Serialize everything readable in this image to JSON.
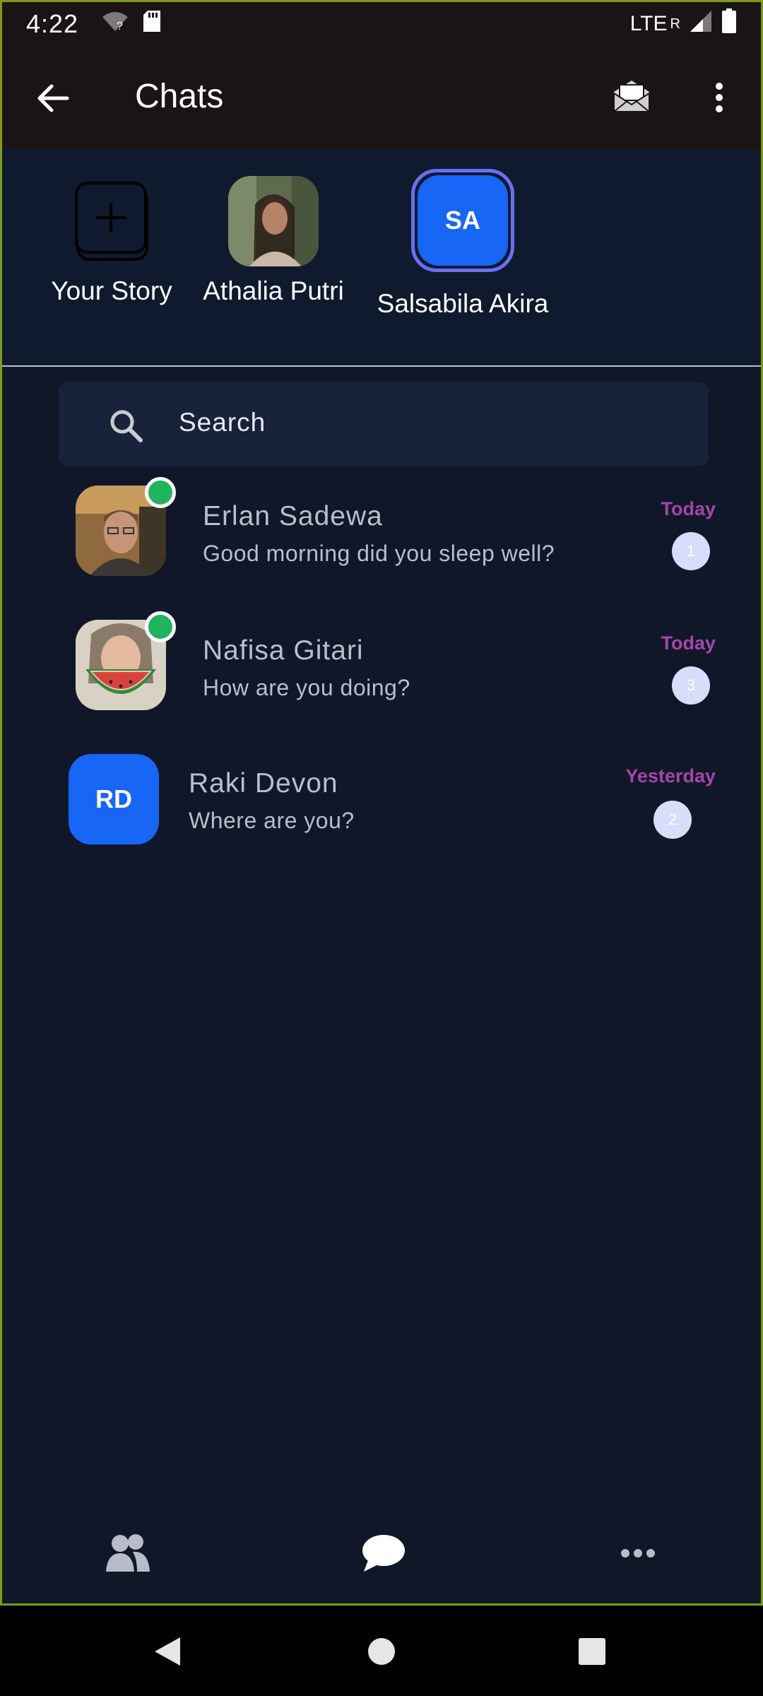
{
  "status_bar": {
    "time": "4:22",
    "network": "LTE",
    "roaming": "R",
    "icons": [
      "wifi-question-icon",
      "sd-card-icon",
      "signal-icon",
      "battery-icon"
    ]
  },
  "app_bar": {
    "title": "Chats",
    "icons": [
      "back-arrow-icon",
      "mail-open-icon",
      "more-vertical-icon"
    ]
  },
  "stories": [
    {
      "label": "Your Story",
      "type": "add"
    },
    {
      "label": "Athalia Putri",
      "type": "photo"
    },
    {
      "label": "Salsabila Akira",
      "type": "initials",
      "initials": "SA"
    }
  ],
  "search": {
    "placeholder": "Search"
  },
  "chats": [
    {
      "name": "Erlan Sadewa",
      "message": "Good morning did you sleep well?",
      "date": "Today",
      "unread": "1",
      "online": true,
      "avatar": "photo"
    },
    {
      "name": "Nafisa Gitari",
      "message": "How are you doing?",
      "date": "Today",
      "unread": "3",
      "online": true,
      "avatar": "photo"
    },
    {
      "name": "Raki Devon",
      "message": "Where are you?",
      "date": "Yesterday",
      "unread": "2",
      "online": false,
      "avatar": "initials",
      "initials": "RD"
    }
  ],
  "bottom_nav": [
    "contacts-icon",
    "chat-bubble-icon",
    "more-horizontal-icon"
  ],
  "colors": {
    "background": "#101729",
    "app_bar": "#1b1416",
    "accent_blue": "#1766f5",
    "date_purple": "#a545a6",
    "online_green": "#22b35e"
  }
}
